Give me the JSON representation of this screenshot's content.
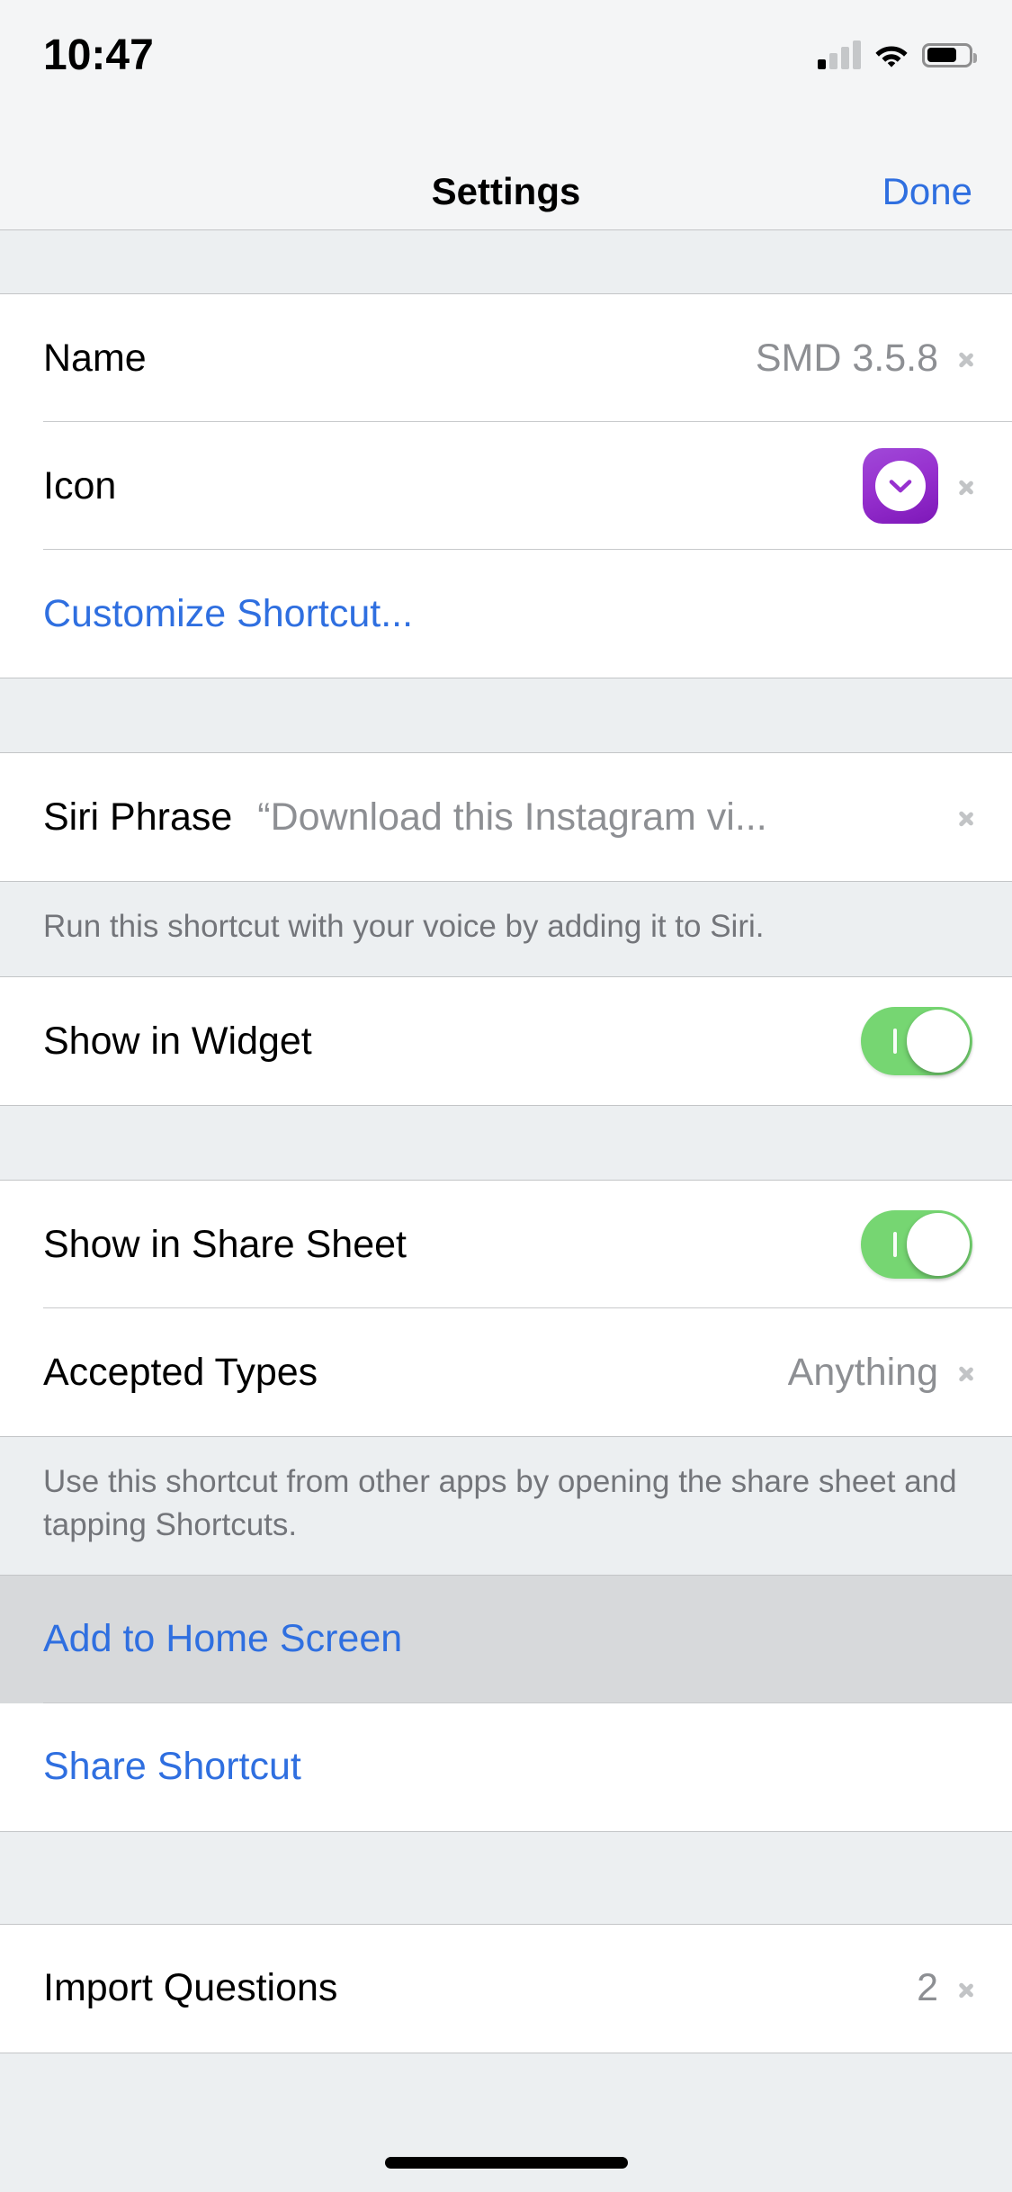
{
  "status_bar": {
    "time": "10:47",
    "cellular_bars_filled": 1,
    "cellular_bars_total": 4,
    "wifi": "wifi-icon",
    "battery_level_percent": 72
  },
  "nav_bar": {
    "title": "Settings",
    "done_label": "Done"
  },
  "colors": {
    "tint_blue": "#2f6fe0",
    "toggle_on_green": "#76d672",
    "icon_purple": "#9731cf",
    "value_gray": "#8d8f93",
    "group_bg": "#eceff1"
  },
  "sections": {
    "details": {
      "rows": [
        {
          "label": "Name",
          "value": "SMD 3.5.8",
          "accessory": "chevron"
        },
        {
          "label": "Icon",
          "value": "",
          "accessory": "icon+chevron",
          "icon": "download-chevron-icon"
        },
        {
          "label": "Customize Shortcut...",
          "value": "",
          "accessory": "none"
        }
      ]
    },
    "siri": {
      "row": {
        "label": "Siri Phrase",
        "value": "“Download this Instagram vi...",
        "accessory": "chevron"
      },
      "footer": "Run this shortcut with your voice by adding it to Siri."
    },
    "widget": {
      "row": {
        "label": "Show in Widget",
        "toggle_on": true
      }
    },
    "share_sheet": {
      "rows": [
        {
          "label": "Show in Share Sheet",
          "toggle_on": true
        },
        {
          "label": "Accepted Types",
          "value": "Anything",
          "accessory": "chevron"
        }
      ],
      "footer": "Use this shortcut from other apps by opening the share sheet and tapping Shortcuts."
    },
    "actions": {
      "rows": [
        {
          "label": "Add to Home Screen",
          "highlighted": true
        },
        {
          "label": "Share Shortcut",
          "highlighted": false
        }
      ]
    },
    "import": {
      "row": {
        "label": "Import Questions",
        "value": "2",
        "accessory": "chevron"
      }
    }
  }
}
